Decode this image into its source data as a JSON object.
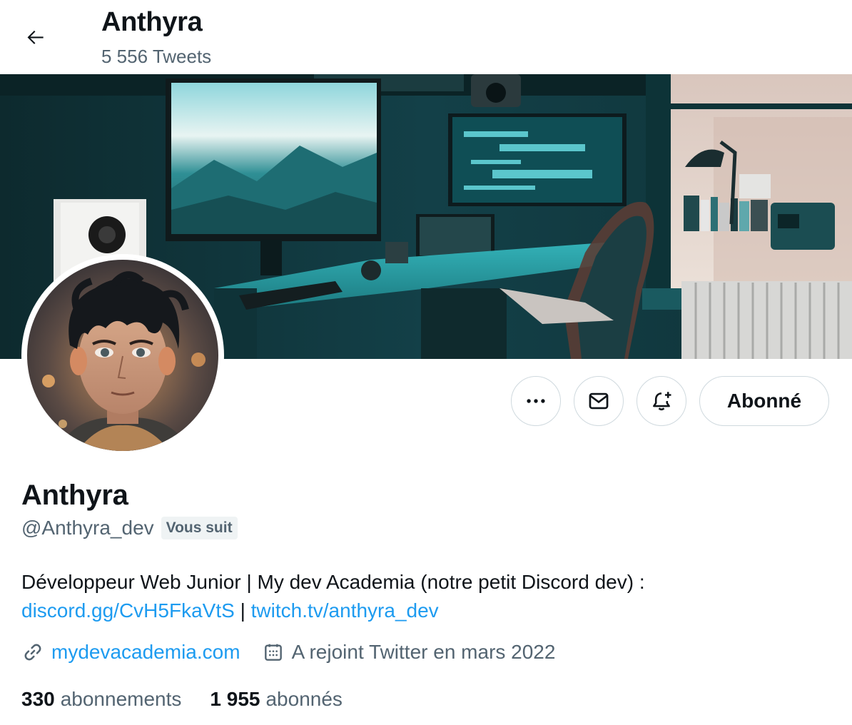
{
  "header": {
    "name": "Anthyra",
    "tweet_count": "5 556 Tweets"
  },
  "actions": {
    "follow_label": "Abonné"
  },
  "profile": {
    "display_name": "Anthyra",
    "handle": "@Anthyra_dev",
    "follows_you_badge": "Vous suit",
    "bio_text": "Développeur Web Junior | My dev Academia (notre petit Discord dev) :",
    "bio_link_1": "discord.gg/CvH5FkaVtS",
    "bio_separator": "|",
    "bio_link_2": "twitch.tv/anthyra_dev",
    "website": "mydevacademia.com",
    "joined": "A rejoint Twitter en mars 2022"
  },
  "stats": {
    "following_count": "330",
    "following_label": "abonnements",
    "followers_count": "1 955",
    "followers_label": "abonnés"
  },
  "colors": {
    "accent": "#1d9bf0",
    "text_primary": "#0f1419",
    "text_secondary": "#536471",
    "border": "#cfd9de"
  }
}
